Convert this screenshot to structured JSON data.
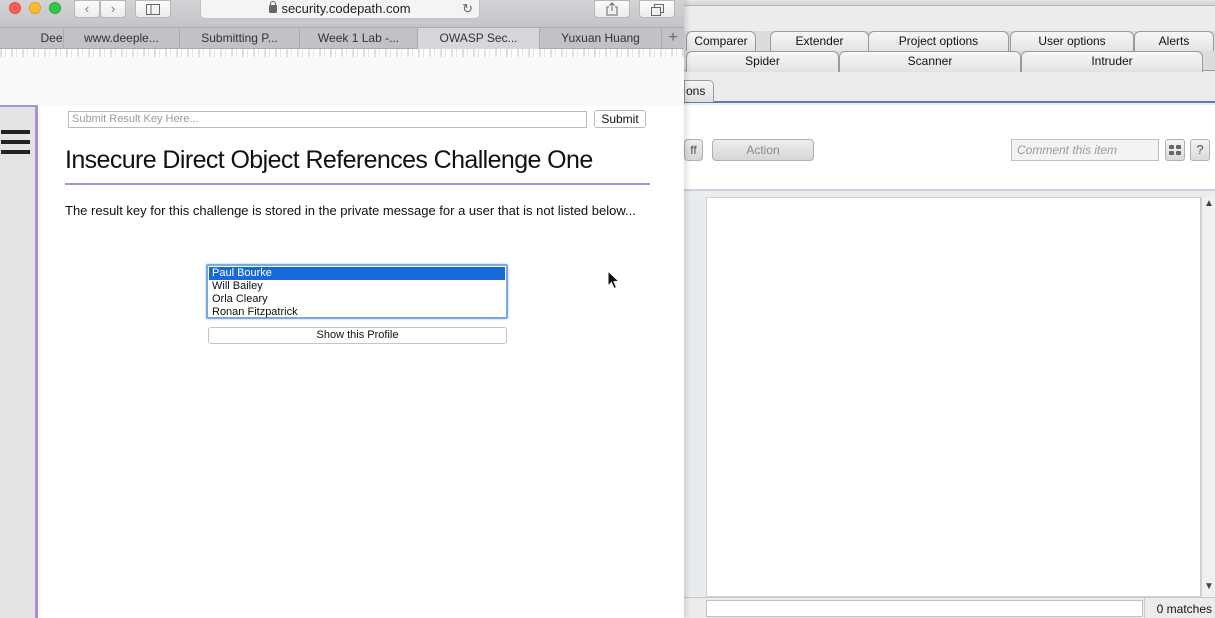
{
  "safari": {
    "url": "security.codepath.com",
    "tabs": [
      {
        "label": "Dee",
        "active": false
      },
      {
        "label": "www.deeple...",
        "active": false
      },
      {
        "label": "Submitting P...",
        "active": false
      },
      {
        "label": "Week 1 Lab -...",
        "active": false
      },
      {
        "label": "OWASP Sec...",
        "active": true
      },
      {
        "label": "Yuxuan Huang",
        "active": false
      }
    ],
    "new_tab_label": "+"
  },
  "page": {
    "submit_placeholder": "Submit Result Key Here...",
    "submit_label": "Submit",
    "title": "Insecure Direct Object References Challenge One",
    "description": "The result key for this challenge is stored in the private message for a user that is not listed below...",
    "users": [
      "Paul Bourke",
      "Will Bailey",
      "Orla Cleary",
      "Ronan Fitzpatrick"
    ],
    "selected_user": "Paul Bourke",
    "show_profile_label": "Show this Profile"
  },
  "burp": {
    "tabs_row1": [
      "Comparer",
      "Extender",
      "Project options",
      "User options",
      "Alerts"
    ],
    "tabs_row2": [
      "Spider",
      "Scanner",
      "Intruder"
    ],
    "subtab_fragment": "ons",
    "off_button_fragment": "ff",
    "action_label": "Action",
    "comment_placeholder": "Comment this item",
    "help_label": "?",
    "matches_label": "0 matches"
  },
  "colors": {
    "accent_purple": "#a98fd4",
    "selection_blue": "#1669d8",
    "burp_rule_blue": "#5b7db6"
  }
}
